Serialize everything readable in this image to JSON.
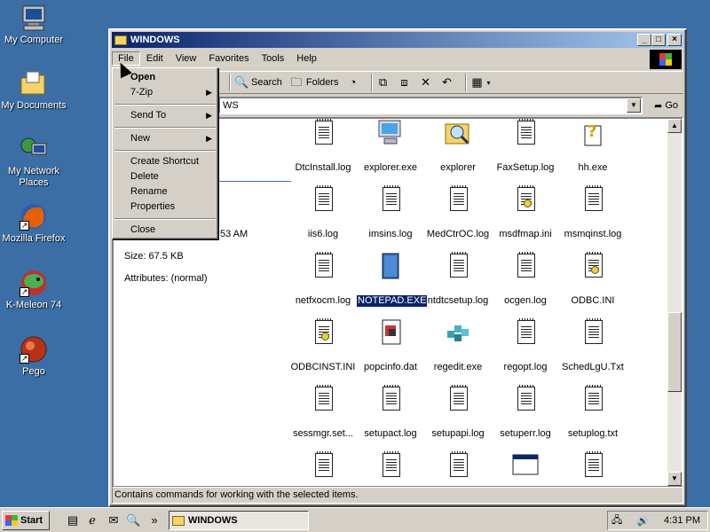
{
  "desktop": {
    "icons": [
      {
        "label": "My Computer",
        "icon": "computer-icon"
      },
      {
        "label": "My Documents",
        "icon": "folder-icon"
      },
      {
        "label": "My Network Places",
        "icon": "network-icon"
      },
      {
        "label": "Mozilla Firefox",
        "icon": "firefox-icon"
      },
      {
        "label": "K-Meleon 74",
        "icon": "kmeleon-icon"
      },
      {
        "label": "Pego",
        "icon": "pego-icon"
      }
    ]
  },
  "window": {
    "title": "WINDOWS",
    "controls": {
      "minimize": "_",
      "maximize": "□",
      "close": "×"
    }
  },
  "menubar": {
    "items": [
      "File",
      "Edit",
      "View",
      "Favorites",
      "Tools",
      "Help"
    ]
  },
  "toolbar": {
    "search_label": "Search",
    "folders_label": "Folders"
  },
  "address": {
    "value": "WS",
    "go_label": "Go"
  },
  "left_pane": {
    "modified_fragment": "53 AM",
    "size": "Size: 67.5 KB",
    "attributes": "Attributes: (normal)"
  },
  "files": [
    {
      "name": "DtcInstall.log",
      "type": "doc"
    },
    {
      "name": "explorer.exe",
      "type": "monitor"
    },
    {
      "name": "explorer",
      "type": "magnifier"
    },
    {
      "name": "FaxSetup.log",
      "type": "doc"
    },
    {
      "name": "hh.exe",
      "type": "help"
    },
    {
      "name": "iis6.log",
      "type": "doc"
    },
    {
      "name": "imsins.log",
      "type": "doc"
    },
    {
      "name": "MedCtrOC.log",
      "type": "doc"
    },
    {
      "name": "msdfmap.ini",
      "type": "ini"
    },
    {
      "name": "msmqinst.log",
      "type": "doc"
    },
    {
      "name": "netfxocm.log",
      "type": "doc"
    },
    {
      "name": "NOTEPAD.EXE",
      "type": "notepad",
      "selected": true
    },
    {
      "name": "ntdtcsetup.log",
      "type": "doc"
    },
    {
      "name": "ocgen.log",
      "type": "doc"
    },
    {
      "name": "ODBC.INI",
      "type": "ini"
    },
    {
      "name": "ODBCINST.INI",
      "type": "ini"
    },
    {
      "name": "popcinfo.dat",
      "type": "dat"
    },
    {
      "name": "regedit.exe",
      "type": "regedit"
    },
    {
      "name": "regopt.log",
      "type": "doc"
    },
    {
      "name": "SchedLgU.Txt",
      "type": "doc"
    },
    {
      "name": "sessmgr.set...",
      "type": "doc"
    },
    {
      "name": "setupact.log",
      "type": "doc"
    },
    {
      "name": "setupapi.log",
      "type": "doc"
    },
    {
      "name": "setuperr.log",
      "type": "doc"
    },
    {
      "name": "setuplog.txt",
      "type": "doc"
    },
    {
      "name": "",
      "type": "doc"
    },
    {
      "name": "",
      "type": "doc"
    },
    {
      "name": "",
      "type": "doc"
    },
    {
      "name": "",
      "type": "window"
    },
    {
      "name": "",
      "type": "doc"
    }
  ],
  "file_menu": {
    "items": [
      {
        "label": "Open",
        "bold": true
      },
      {
        "label": "7-Zip",
        "submenu": true
      },
      {
        "sep": true
      },
      {
        "label": "Send To",
        "submenu": true
      },
      {
        "sep": true
      },
      {
        "label": "New",
        "submenu": true
      },
      {
        "sep": true
      },
      {
        "label": "Create Shortcut"
      },
      {
        "label": "Delete"
      },
      {
        "label": "Rename"
      },
      {
        "label": "Properties"
      },
      {
        "sep": true
      },
      {
        "label": "Close"
      }
    ]
  },
  "statusbar": {
    "text": "Contains commands for working with the selected items."
  },
  "taskbar": {
    "start_label": "Start",
    "task_label": "WINDOWS",
    "clock": "4:31 PM",
    "chevron": "»"
  }
}
